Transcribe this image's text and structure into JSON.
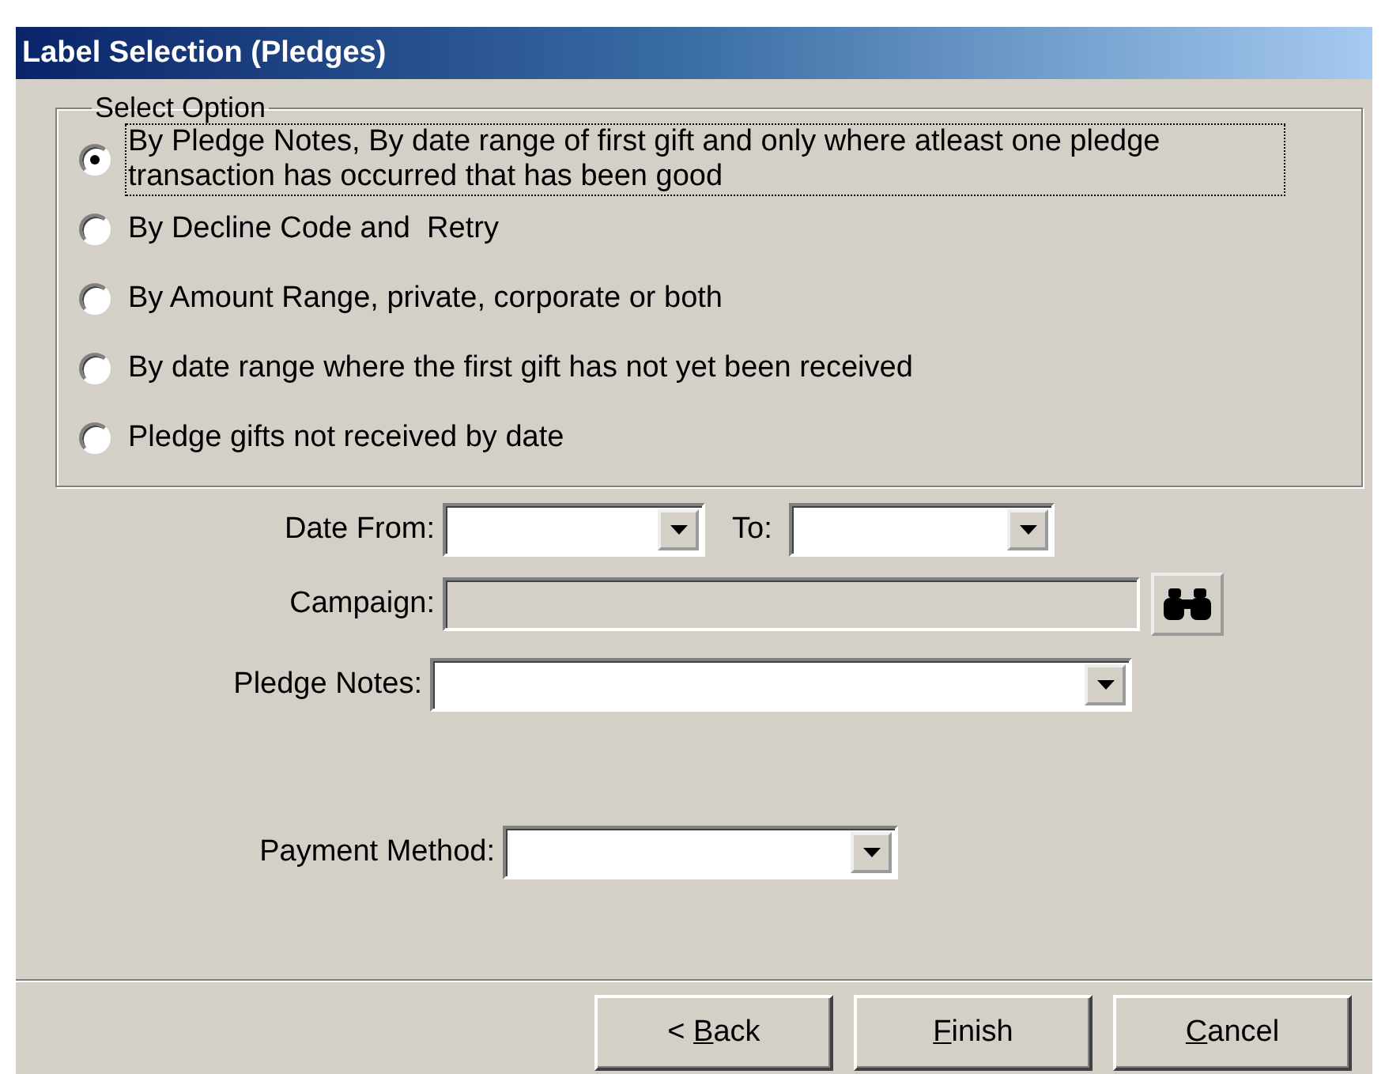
{
  "window": {
    "title": "Label Selection (Pledges)"
  },
  "option_group": {
    "title": "Select Option",
    "options": [
      {
        "label": "By Pledge Notes, By date range of first gift and only where atleast one pledge transaction has occurred that has been good",
        "selected": true,
        "focused": true
      },
      {
        "label": "By Decline Code and  Retry",
        "selected": false,
        "focused": false
      },
      {
        "label": "By Amount Range, private, corporate or both",
        "selected": false,
        "focused": false
      },
      {
        "label": "By date range where the first gift has not yet been received",
        "selected": false,
        "focused": false
      },
      {
        "label": "Pledge gifts not received by date",
        "selected": false,
        "focused": false
      }
    ]
  },
  "date_from": {
    "label": "Date From:"
  },
  "date_to": {
    "label": "To:"
  },
  "campaign": {
    "label": "Campaign:",
    "disabled": true
  },
  "pledge_notes": {
    "label": "Pledge Notes:"
  },
  "payment_method": {
    "label": "Payment Method:"
  },
  "buttons": [
    {
      "before": "< ",
      "key": "B",
      "after": "ack"
    },
    {
      "key": "F",
      "after": "inish"
    },
    {
      "key": "C",
      "after": "ancel"
    }
  ]
}
